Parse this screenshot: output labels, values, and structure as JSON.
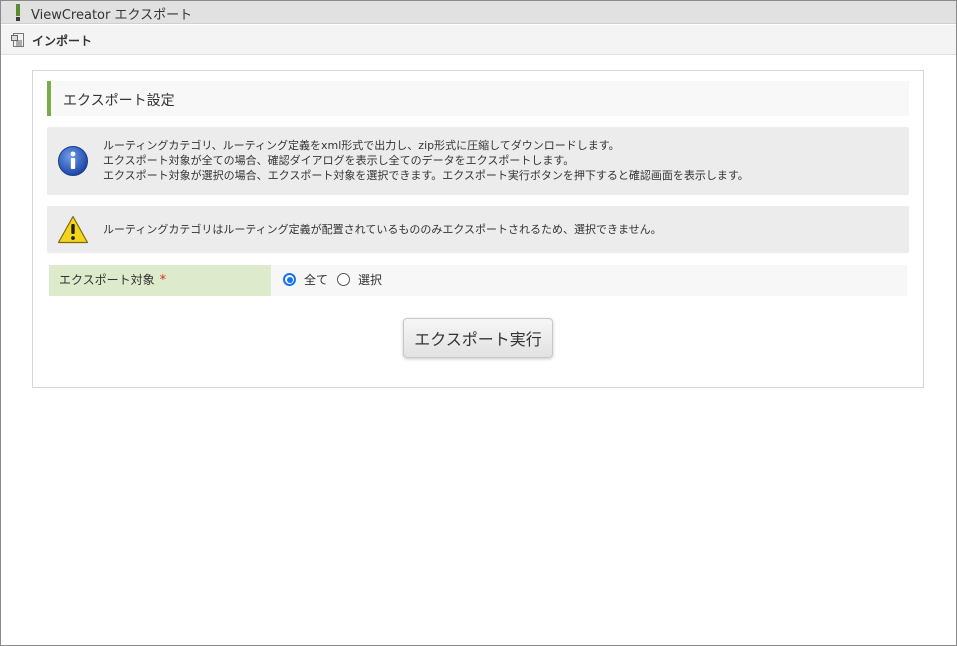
{
  "window": {
    "title": "ViewCreator エクスポート",
    "accent_color": "#5c8a2e"
  },
  "toolbar": {
    "import_label": "インポート",
    "import_icon": "document-import-icon"
  },
  "section": {
    "title": "エクスポート設定",
    "accent_color": "#7aab47"
  },
  "info_message": {
    "icon": "info-icon",
    "lines": [
      "ルーティングカテゴリ、ルーティング定義をxml形式で出力し、zip形式に圧縮してダウンロードします。",
      "エクスポート対象が全ての場合、確認ダイアログを表示し全てのデータをエクスポートします。",
      "エクスポート対象が選択の場合、エクスポート対象を選択できます。エクスポート実行ボタンを押下すると確認画面を表示します。"
    ]
  },
  "warning_message": {
    "icon": "warning-icon",
    "text": "ルーティングカテゴリはルーティング定義が配置されているもののみエクスポートされるため、選択できません。"
  },
  "form": {
    "target_label": "エクスポート対象",
    "required_mark": "*",
    "options": [
      {
        "label": "全て",
        "checked": true
      },
      {
        "label": "選択",
        "checked": false
      }
    ]
  },
  "actions": {
    "execute_label": "エクスポート実行"
  }
}
